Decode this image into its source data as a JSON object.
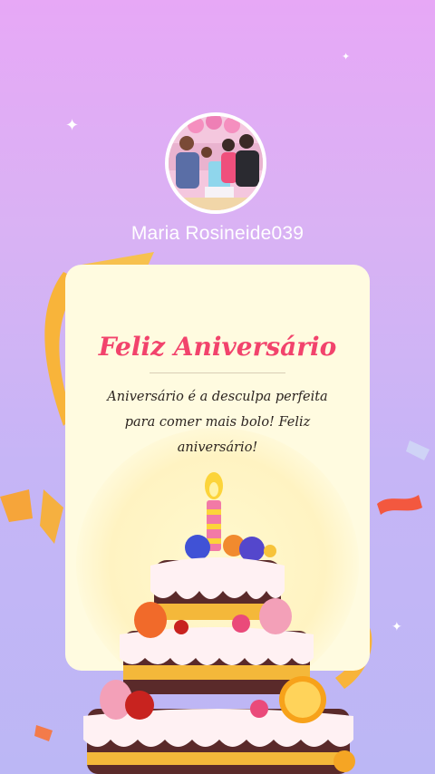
{
  "profile": {
    "username": "Maria Rosineide039"
  },
  "card": {
    "title": "Feliz Aniversário",
    "message": "Aniversário é a desculpa perfeita para comer mais bolo! Feliz aniversário!"
  },
  "colors": {
    "background_top": "#e7a8f6",
    "background_bottom": "#bcb7f5",
    "title": "#f2436c",
    "card": "#fffbe0"
  }
}
